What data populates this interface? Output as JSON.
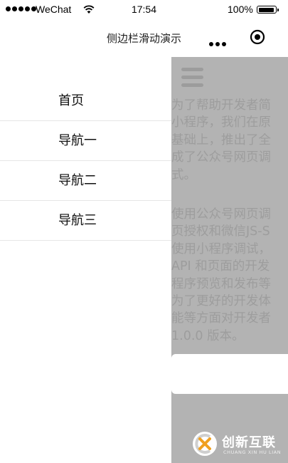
{
  "status_bar": {
    "carrier": "WeChat",
    "time": "17:54",
    "battery": "100%",
    "battery_level": 1.0
  },
  "nav_bar": {
    "title": "侧边栏滑动演示"
  },
  "sidebar": {
    "items": [
      {
        "label": "首页"
      },
      {
        "label": "导航一"
      },
      {
        "label": "导航二"
      },
      {
        "label": "导航三"
      }
    ]
  },
  "main": {
    "paragraph_1": "为了帮助开发者简\n小程序，我们在原\n基础上，推出了全\n成了公众号网页调\n式。",
    "paragraph_2": "使用公众号网页调\n页授权和微信JS-S\n使用小程序调试，\nAPI 和页面的开发\n程序预览和发布等\n为了更好的开发体\n能等方面对开发者\n1.0.0 版本。"
  },
  "watermark": {
    "title": "创新互联",
    "subtitle": "CHUANG XIN HU LIAN"
  },
  "colors": {
    "overlay_gray": "#b3b3b3",
    "text_gray": "#9d9d9d",
    "divider": "#e6e6e6",
    "watermark_orange": "#f0a020"
  }
}
